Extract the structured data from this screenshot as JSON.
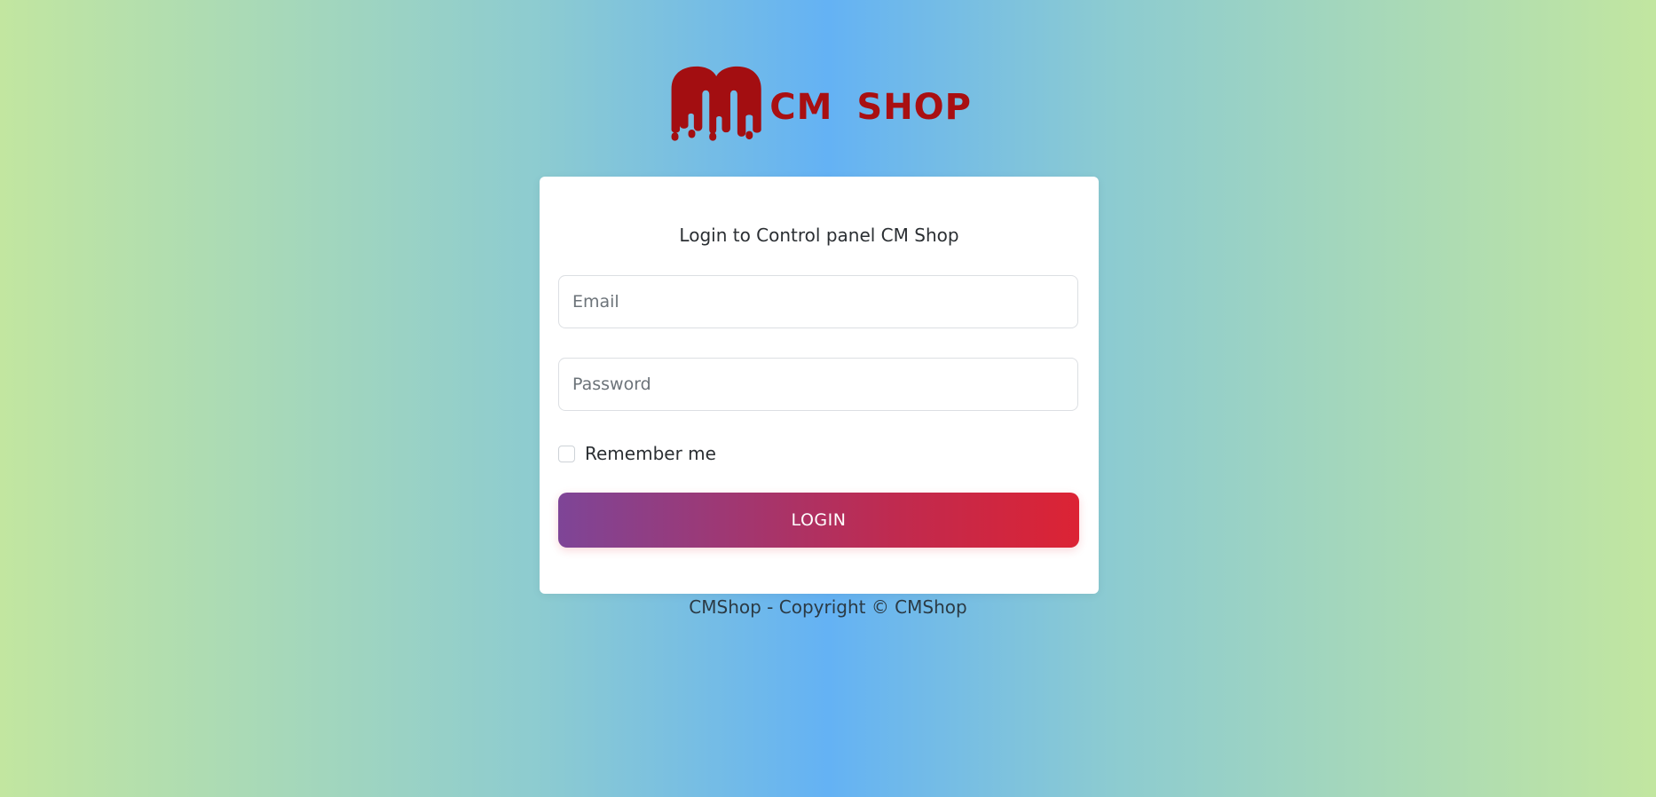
{
  "logo": {
    "text": "CM SHOP",
    "icon": "dripping-m-logo-icon",
    "color": "#a90f12"
  },
  "login": {
    "title": "Login to Control panel CM Shop",
    "email_placeholder": "Email",
    "email_value": "",
    "password_placeholder": "Password",
    "password_value": "",
    "remember_label": "Remember me",
    "remember_checked": false,
    "button_label": "LOGIN",
    "button_gradient": [
      "#7e4597",
      "#dc2334"
    ]
  },
  "footer": {
    "text": "CMShop - Copyright © CMShop"
  }
}
